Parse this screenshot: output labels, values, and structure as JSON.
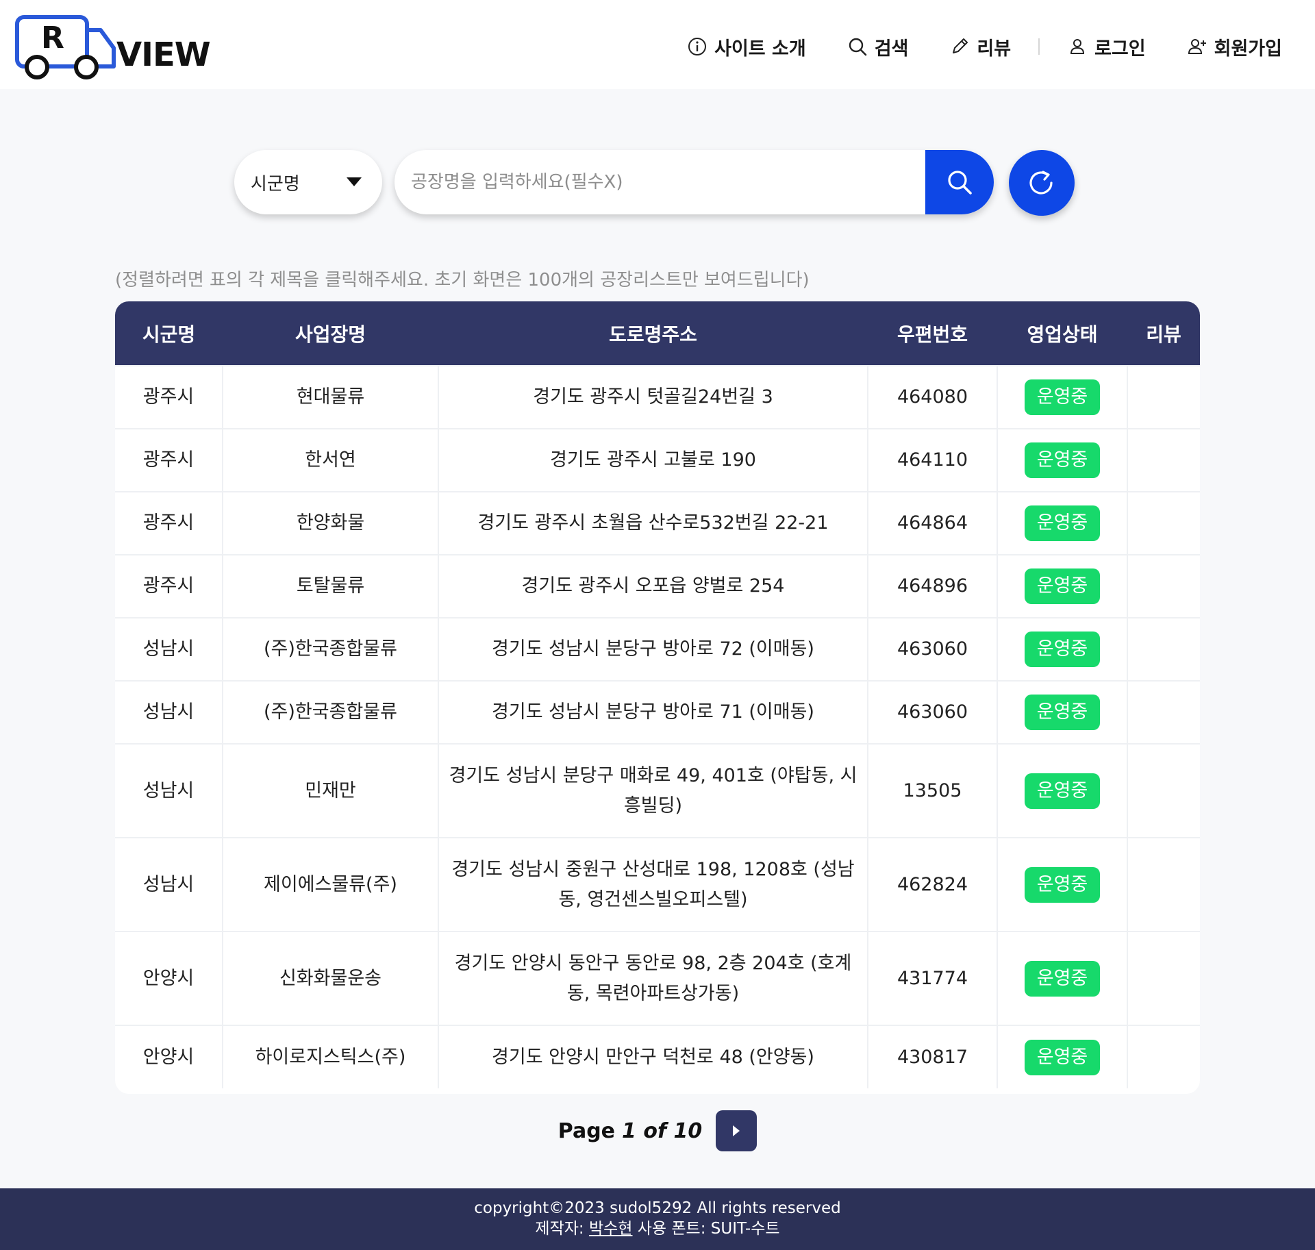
{
  "header": {
    "logo_text": "VIEW",
    "logo_letter": "R",
    "nav": [
      {
        "label": "사이트 소개",
        "icon": "info-icon"
      },
      {
        "label": "검색",
        "icon": "search-icon"
      },
      {
        "label": "리뷰",
        "icon": "pencil-icon"
      },
      {
        "label": "로그인",
        "icon": "user-icon"
      },
      {
        "label": "회원가입",
        "icon": "user-plus-icon"
      }
    ]
  },
  "search": {
    "select_value": "시군명",
    "placeholder": "공장명을 입력하세요(필수X)"
  },
  "hint": "(정렬하려면 표의 각 제목을 클릭해주세요. 초기 화면은 100개의 공장리스트만 보여드립니다)",
  "table": {
    "headers": [
      "시군명",
      "사업장명",
      "도로명주소",
      "우편번호",
      "영업상태",
      "리뷰"
    ],
    "rows": [
      {
        "city": "광주시",
        "name": "현대물류",
        "address": "경기도 광주시 텃골길24번길 3",
        "zip": "464080",
        "status": "운영중",
        "review": ""
      },
      {
        "city": "광주시",
        "name": "한서연",
        "address": "경기도 광주시 고불로 190",
        "zip": "464110",
        "status": "운영중",
        "review": ""
      },
      {
        "city": "광주시",
        "name": "한양화물",
        "address": "경기도 광주시 초월읍 산수로532번길 22-21",
        "zip": "464864",
        "status": "운영중",
        "review": ""
      },
      {
        "city": "광주시",
        "name": "토탈물류",
        "address": "경기도 광주시 오포읍 양벌로 254",
        "zip": "464896",
        "status": "운영중",
        "review": ""
      },
      {
        "city": "성남시",
        "name": "(주)한국종합물류",
        "address": "경기도 성남시 분당구 방아로 72 (이매동)",
        "zip": "463060",
        "status": "운영중",
        "review": ""
      },
      {
        "city": "성남시",
        "name": "(주)한국종합물류",
        "address": "경기도 성남시 분당구 방아로 71 (이매동)",
        "zip": "463060",
        "status": "운영중",
        "review": ""
      },
      {
        "city": "성남시",
        "name": "민재만",
        "address": "경기도 성남시 분당구 매화로 49, 401호 (야탑동, 시흥빌딩)",
        "zip": "13505",
        "status": "운영중",
        "review": ""
      },
      {
        "city": "성남시",
        "name": "제이에스물류(주)",
        "address": "경기도 성남시 중원구 산성대로 198, 1208호 (성남동, 영건센스빌오피스텔)",
        "zip": "462824",
        "status": "운영중",
        "review": ""
      },
      {
        "city": "안양시",
        "name": "신화화물운송",
        "address": "경기도 안양시 동안구 동안로 98, 2층 204호 (호계동, 목련아파트상가동)",
        "zip": "431774",
        "status": "운영중",
        "review": ""
      },
      {
        "city": "안양시",
        "name": "하이로지스틱스(주)",
        "address": "경기도 안양시 만안구 덕천로 48 (안양동)",
        "zip": "430817",
        "status": "운영중",
        "review": ""
      }
    ]
  },
  "pagination": {
    "word": "Page",
    "current": "1 of 10"
  },
  "footer": {
    "copyright": "copyright©2023 sudol5292 All rights reserved",
    "author_label": "제작자:",
    "author_name": "박수현",
    "font_label": "사용 폰트: SUIT-수트"
  },
  "colors": {
    "primary": "#0e47e6",
    "header_bg": "#313766",
    "footer_bg": "#2c3157",
    "status_green": "#17d96b"
  }
}
